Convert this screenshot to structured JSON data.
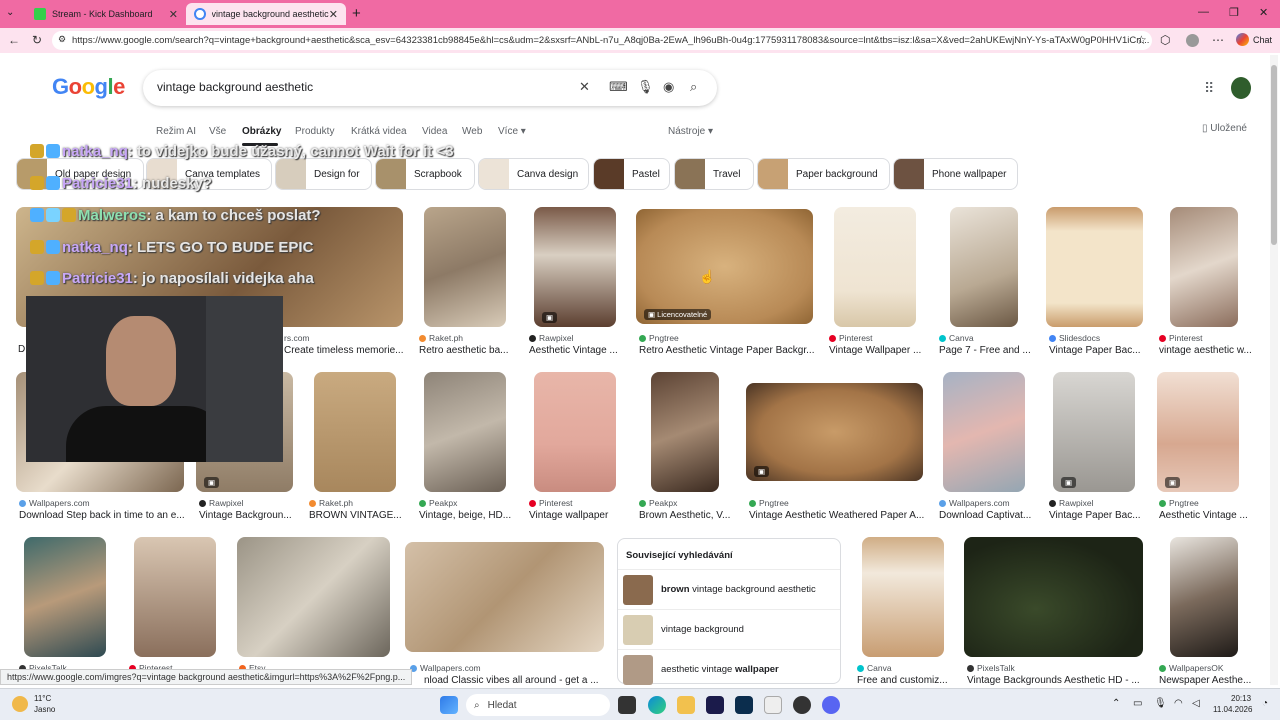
{
  "tabs": [
    {
      "label": "Stream - Kick Dashboard",
      "favicon_color": "#35d04b"
    },
    {
      "label": "vintage background aesthetic - Hle",
      "favicon_color": "#4285f4"
    }
  ],
  "address": {
    "url": "https://www.google.com/search?q=vintage+background+aesthetic&sca_esv=64323381cb98845e&hl=cs&udm=2&sxsrf=ANbL-n7u_A8qj0Ba-2EwA_lh96uBh-0u4g:1775931178083&source=lnt&tbs=isz:l&sa=X&ved=2ahUKEwjNnY-Ys-aTAxW0gP0HHV1iCn..."
  },
  "browser": {
    "chat_label": "Chat"
  },
  "search": {
    "query": "vintage background aesthetic"
  },
  "nav": {
    "items": [
      "Režim AI",
      "Vše",
      "Obrázky",
      "Produkty",
      "Krátká videa",
      "Videa",
      "Web",
      "Více"
    ],
    "tools": "Nástroje",
    "saved": "Uložené"
  },
  "chips": [
    "Old paper design",
    "Canva templates",
    "Design for",
    "Scrapbook",
    "Canva design",
    "Pastel",
    "Travel",
    "Paper background",
    "Phone wallpaper"
  ],
  "chat": [
    {
      "user": "natka_nq",
      "text": ": to videjko bude úžasný, cannot Wait for it <3"
    },
    {
      "user": "Patricie31",
      "text": ": nudesky?"
    },
    {
      "user": "Malweros",
      "text": ": a kam to chceš poslat?"
    },
    {
      "user": "natka_nq",
      "text": ": LETS GO TO BUDE EPIC"
    },
    {
      "user": "Patricie31",
      "text": ": jo naposílali videjka aha"
    }
  ],
  "row1": [
    {
      "source": "Raket.ph",
      "title": "Retro aesthetic ba..."
    },
    {
      "source": "Rawpixel",
      "title": "Aesthetic Vintage ..."
    },
    {
      "source": "Pngtree",
      "title": "Retro Aesthetic Vintage Paper Backgr...",
      "badge": "Licencovatelné"
    },
    {
      "source": "Pinterest",
      "title": "Vintage Wallpaper ..."
    },
    {
      "source": "Canva",
      "title": "Page 7 - Free and ..."
    },
    {
      "source": "Slidesdocs",
      "title": "Vintage Paper Bac..."
    },
    {
      "source": "Pinterest",
      "title": "vintage aesthetic w..."
    }
  ],
  "row1_partial": {
    "prefix": "D",
    "title": "Create timeless memorie...",
    "source_tail": "rs.com"
  },
  "row2": [
    {
      "source": "Wallpapers.com",
      "title": "Download Step back in time to an e..."
    },
    {
      "source": "Rawpixel",
      "title": "Vintage Backgroun..."
    },
    {
      "source": "Raket.ph",
      "title": "BROWN VINTAGE..."
    },
    {
      "source": "Peakpx",
      "title": "Vintage, beige, HD..."
    },
    {
      "source": "Pinterest",
      "title": "Vintage wallpaper"
    },
    {
      "source": "Peakpx",
      "title": "Brown Aesthetic, V..."
    },
    {
      "source": "Pngtree",
      "title": "Vintage Aesthetic Weathered Paper A..."
    },
    {
      "source": "Wallpapers.com",
      "title": "Download Captivat..."
    },
    {
      "source": "Rawpixel",
      "title": "Vintage Paper Bac..."
    },
    {
      "source": "Pngtree",
      "title": "Aesthetic Vintage ..."
    }
  ],
  "row3": [
    {
      "source": "PixelsTalk",
      "title": ""
    },
    {
      "source": "Pinterest",
      "title": ""
    },
    {
      "source": "Etsy",
      "title": ""
    },
    {
      "source": "Wallpapers.com",
      "title": "nload Classic vibes all around - get a ..."
    },
    {
      "source": "Canva",
      "title": "Free and customiz..."
    },
    {
      "source": "PixelsTalk",
      "title": "Vintage Backgrounds Aesthetic HD - ..."
    },
    {
      "source": "WallpapersOK",
      "title": "Newspaper Aesthe..."
    }
  ],
  "related": {
    "heading": "Související vyhledávání",
    "items": [
      {
        "bold": "brown",
        "rest": " vintage background aesthetic"
      },
      {
        "bold": "",
        "rest": "vintage background"
      },
      {
        "bold": "wallpaper",
        "pre": "aesthetic vintage "
      }
    ]
  },
  "status_url": "https://www.google.com/imgres?q=vintage background aesthetic&imgurl=https%3A%2F%2Fpng.p...",
  "taskbar": {
    "weather_temp": "11°C",
    "weather_desc": "Jasno",
    "search_placeholder": "Hledat",
    "time": "20:13",
    "date": "11.04.2026"
  }
}
